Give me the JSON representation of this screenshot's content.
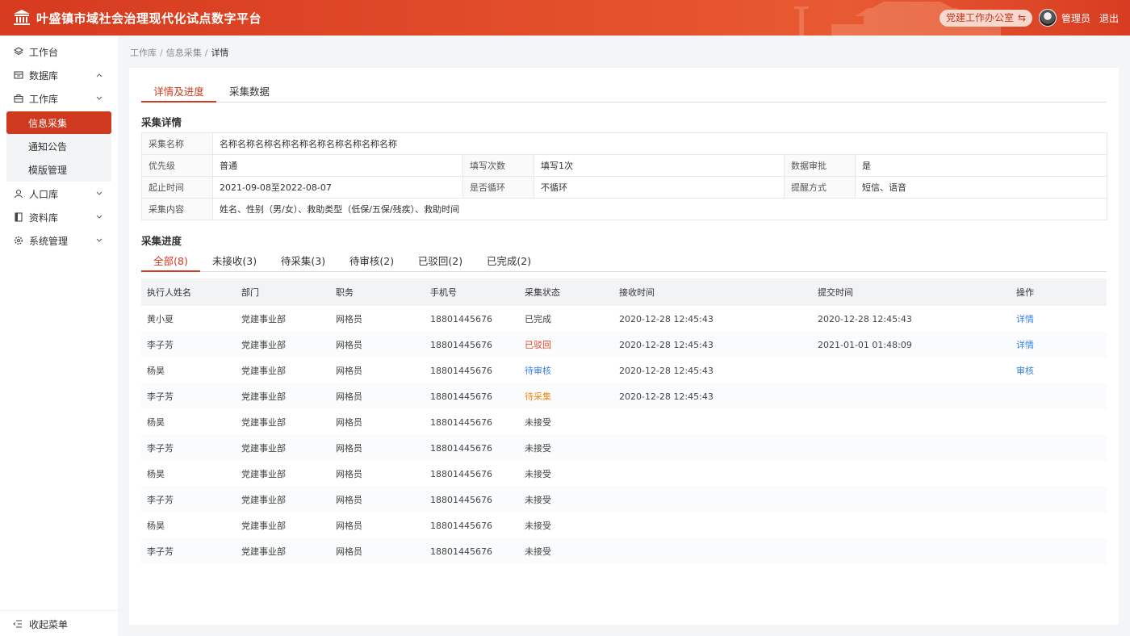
{
  "header": {
    "title": "叶盛镇市域社会治理现代化试点数字平台",
    "office_switch": "党建工作办公室",
    "switch_icon": "⇆",
    "user_name": "管理员",
    "logout": "退出",
    "colors": {
      "brand": "#d63a1f",
      "accent": "#cf3a1e"
    }
  },
  "sidebar": {
    "items": [
      {
        "label": "工作台",
        "icon": "layers-icon"
      },
      {
        "label": "数据库",
        "icon": "database-icon"
      },
      {
        "label": "工作库",
        "icon": "briefcase-icon"
      },
      {
        "label": "人口库",
        "icon": "user-icon"
      },
      {
        "label": "资料库",
        "icon": "book-icon"
      },
      {
        "label": "系统管理",
        "icon": "gear-icon"
      }
    ],
    "sub_items": [
      "信息采集",
      "通知公告",
      "模版管理"
    ],
    "active_sub": "信息采集",
    "collapse": "收起菜单"
  },
  "breadcrumb": [
    "工作库",
    "信息采集",
    "详情"
  ],
  "tabs": [
    "详情及进度",
    "采集数据"
  ],
  "detail": {
    "title": "采集详情",
    "name_label": "采集名称",
    "name_value": "名称名称名称名称名称名称名称名称名称名称",
    "priority_label": "优先级",
    "priority_value": "普通",
    "fill_count_label": "填写次数",
    "fill_count_value": "填写1次",
    "audit_label": "数据审批",
    "audit_value": "是",
    "period_label": "起止时间",
    "period_value": "2021-09-08至2022-08-07",
    "loop_label": "是否循环",
    "loop_value": "不循环",
    "remind_label": "提醒方式",
    "remind_value": "短信、语音",
    "content_label": "采集内容",
    "content_value": "姓名、性别（男/女）、救助类型（低保/五保/残疾）、救助时间"
  },
  "progress": {
    "title": "采集进度",
    "tabs": [
      "全部(8)",
      "未接收(3)",
      "待采集(3)",
      "待审核(2)",
      "已驳回(2)",
      "已完成(2)"
    ],
    "columns": [
      "执行人姓名",
      "部门",
      "职务",
      "手机号",
      "采集状态",
      "接收时间",
      "提交时间",
      "操作"
    ],
    "rows": [
      {
        "name": "黄小夏",
        "dept": "党建事业部",
        "role": "网格员",
        "phone": "18801445676",
        "status": "已完成",
        "status_type": "done",
        "recv": "2020-12-28 12:45:43",
        "submit": "2020-12-28 12:45:43",
        "op": "详情"
      },
      {
        "name": "李子芳",
        "dept": "党建事业部",
        "role": "网格员",
        "phone": "18801445676",
        "status": "已驳回",
        "status_type": "reject",
        "recv": "2020-12-28 12:45:43",
        "submit": "2021-01-01 01:48:09",
        "op": "详情"
      },
      {
        "name": "杨昊",
        "dept": "党建事业部",
        "role": "网格员",
        "phone": "18801445676",
        "status": "待审核",
        "status_type": "review",
        "recv": "2020-12-28 12:45:43",
        "submit": "",
        "op": "审核"
      },
      {
        "name": "李子芳",
        "dept": "党建事业部",
        "role": "网格员",
        "phone": "18801445676",
        "status": "待采集",
        "status_type": "collect",
        "recv": "2020-12-28 12:45:43",
        "submit": "",
        "op": ""
      },
      {
        "name": "杨昊",
        "dept": "党建事业部",
        "role": "网格员",
        "phone": "18801445676",
        "status": "未接受",
        "status_type": "none",
        "recv": "",
        "submit": "",
        "op": ""
      },
      {
        "name": "李子芳",
        "dept": "党建事业部",
        "role": "网格员",
        "phone": "18801445676",
        "status": "未接受",
        "status_type": "none",
        "recv": "",
        "submit": "",
        "op": ""
      },
      {
        "name": "杨昊",
        "dept": "党建事业部",
        "role": "网格员",
        "phone": "18801445676",
        "status": "未接受",
        "status_type": "none",
        "recv": "",
        "submit": "",
        "op": ""
      },
      {
        "name": "李子芳",
        "dept": "党建事业部",
        "role": "网格员",
        "phone": "18801445676",
        "status": "未接受",
        "status_type": "none",
        "recv": "",
        "submit": "",
        "op": ""
      },
      {
        "name": "杨昊",
        "dept": "党建事业部",
        "role": "网格员",
        "phone": "18801445676",
        "status": "未接受",
        "status_type": "none",
        "recv": "",
        "submit": "",
        "op": ""
      },
      {
        "name": "李子芳",
        "dept": "党建事业部",
        "role": "网格员",
        "phone": "18801445676",
        "status": "未接受",
        "status_type": "none",
        "recv": "",
        "submit": "",
        "op": ""
      }
    ]
  }
}
